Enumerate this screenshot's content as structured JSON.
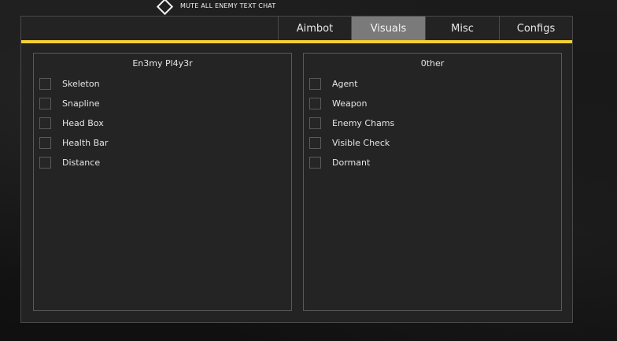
{
  "topbar": {
    "label": "MUTE ALL ENEMY TEXT CHAT",
    "icon": "diamond-icon"
  },
  "tabs": [
    {
      "label": "Aimbot",
      "active": false
    },
    {
      "label": "Visuals",
      "active": true
    },
    {
      "label": "Misc",
      "active": false
    },
    {
      "label": "Configs",
      "active": false
    }
  ],
  "colors": {
    "accent": "#f5cf33",
    "active_tab": "#7a7a7a",
    "panel_bg": "#232323"
  },
  "panels": {
    "left": {
      "title": "En3my Pl4y3r",
      "options": [
        {
          "label": "Skeleton",
          "checked": false
        },
        {
          "label": "Snapline",
          "checked": false
        },
        {
          "label": "Head Box",
          "checked": false
        },
        {
          "label": "Health Bar",
          "checked": false
        },
        {
          "label": "Distance",
          "checked": false
        }
      ]
    },
    "right": {
      "title": "0ther",
      "options": [
        {
          "label": "Agent",
          "checked": false
        },
        {
          "label": "Weapon",
          "checked": false
        },
        {
          "label": "Enemy Chams",
          "checked": false
        },
        {
          "label": "Visible Check",
          "checked": false
        },
        {
          "label": "Dormant",
          "checked": false
        }
      ]
    }
  }
}
